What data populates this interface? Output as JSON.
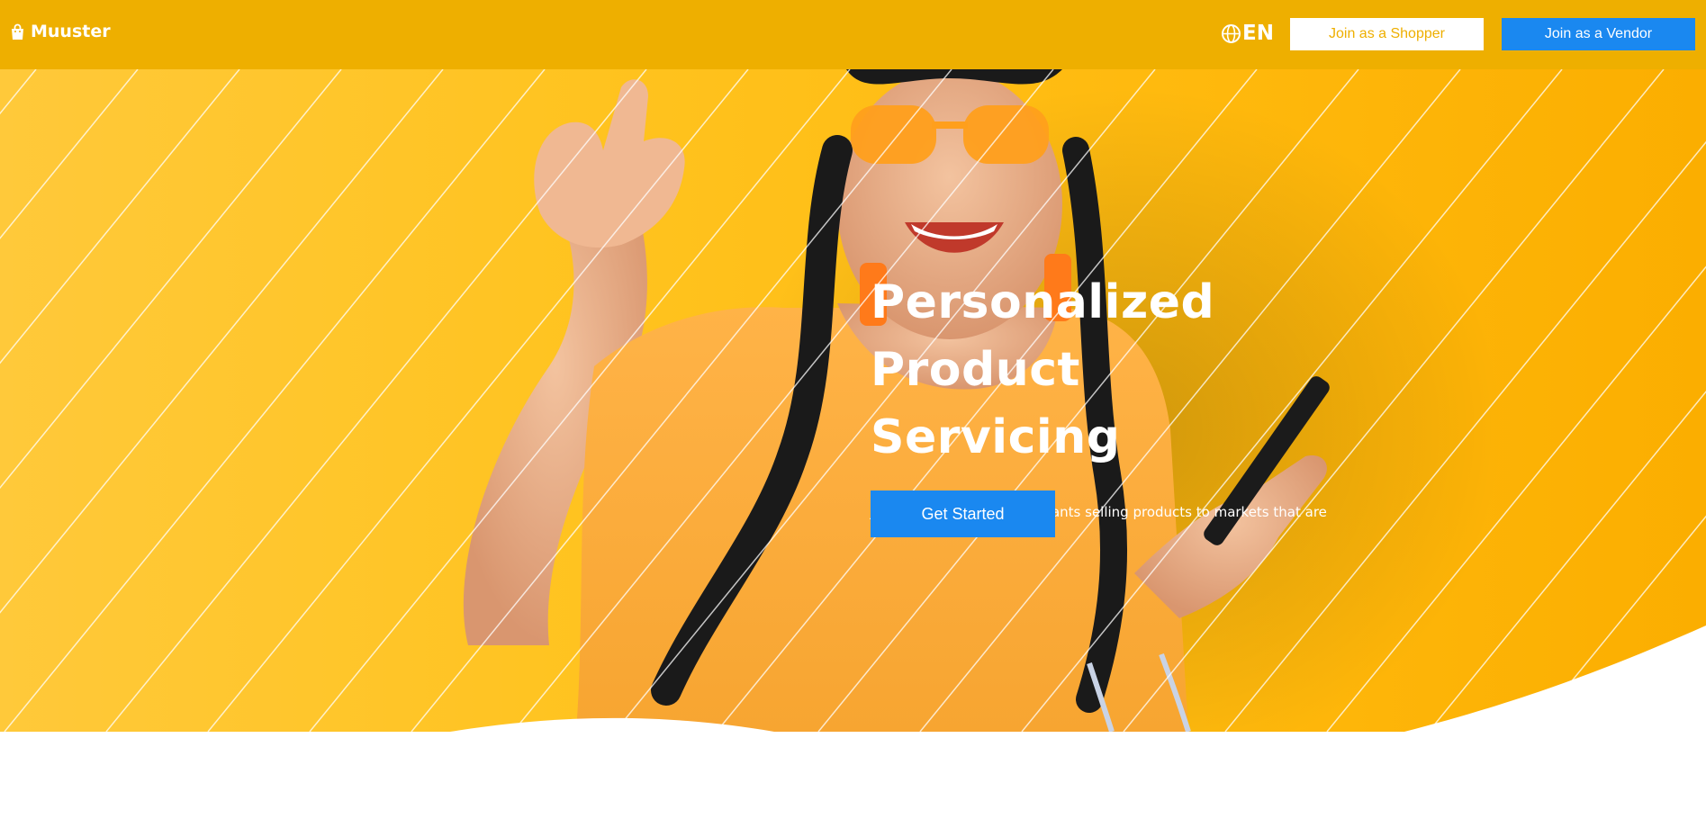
{
  "header": {
    "brand": "Muuster",
    "brand_icon": "shopping-bag-icon",
    "language": "EN",
    "language_icon": "globe-icon",
    "shopper_button": "Join as a Shopper",
    "vendor_button": "Join as a Vendor"
  },
  "hero": {
    "title_line1": "Personalized",
    "title_line2": "Product Servicing",
    "subtitle": "Join millions of local merchants selling products to markets that are suited for your products.",
    "cta_button": "Get Started",
    "image_subject": "smiling woman in orange top and orange sunglasses holding a phone"
  },
  "colors": {
    "header_bg": "#EEAF00",
    "accent_yellow": "#FFC31F",
    "primary_blue": "#1A88F0",
    "text_white": "#ffffff"
  }
}
